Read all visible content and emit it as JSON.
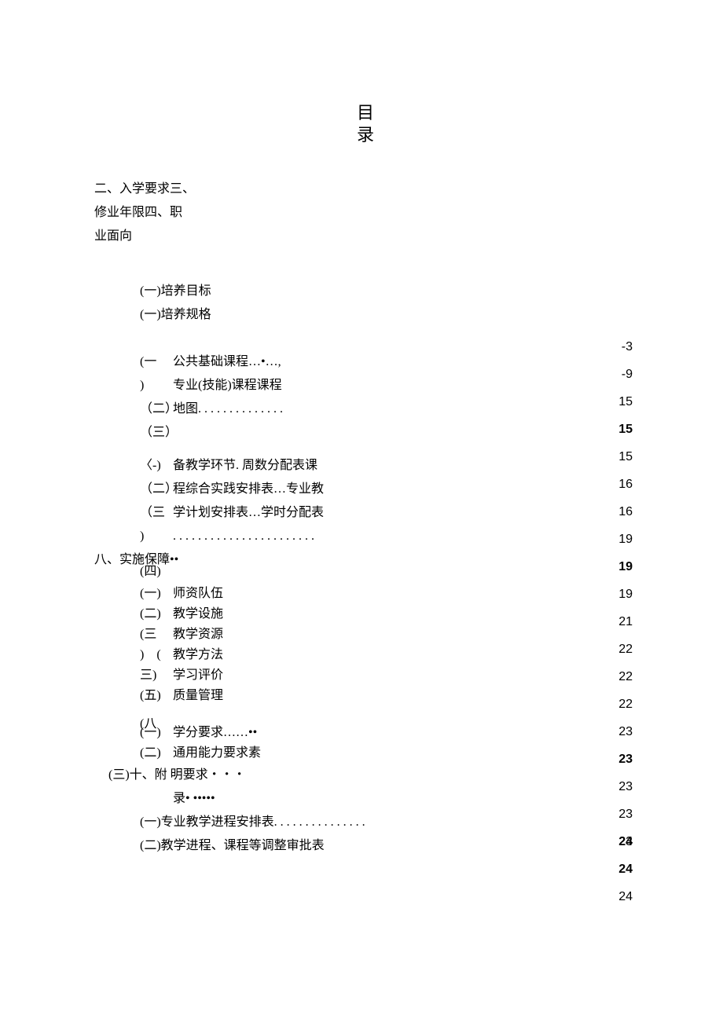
{
  "title_line1": "目",
  "title_line2": "录",
  "intro": {
    "l1": "二、入学要求三、",
    "l2": "修业年限四、职",
    "l3": "业面向"
  },
  "block1": {
    "a": "(一)培养目标",
    "b": "(一)培养规格"
  },
  "rows": [
    {
      "label": "(一",
      "text": "公共基础课程…•…,"
    },
    {
      "label": ")",
      "text": "专业(技能)课程课程"
    },
    {
      "label": "（二）",
      "text": "地图. . . . . . . . . . . . . ."
    },
    {
      "label": "（三）",
      "text": ""
    },
    {
      "label": "〈-)",
      "text": "备教学环节. 周数分配表课"
    },
    {
      "label": "（二）",
      "text": "程综合实践安排表…专业教"
    },
    {
      "label": "（三",
      "text": "学计划安排表…学时分配表"
    },
    {
      "label": ")",
      "text": ". . . . . . . . . . . . . . . . . . . . . . ."
    }
  ],
  "eight": "八、实施保障••",
  "eight_overlay": "(四)",
  "block3": [
    {
      "label": "(一)",
      "text": "师资队伍"
    },
    {
      "label": "(二)",
      "text": "教学设施"
    },
    {
      "label": "(三",
      "text": "教学资源"
    },
    {
      "label": ")　(",
      "text": "教学方法"
    },
    {
      "label": "三)",
      "text": "学习评价"
    },
    {
      "label": "(五)",
      "text": "质量管理"
    }
  ],
  "block4": [
    {
      "label": "(八",
      "text": ""
    },
    {
      "label": "(一)",
      "text": "学分要求……••"
    },
    {
      "label": "(二)",
      "text": "通用能力要求素"
    }
  ],
  "line_san": "(三)十、附 明要求・・・",
  "line_lu": "录• •••••",
  "appendix": {
    "a": "(一)专业教学进程安排表. . . . . . . . . . . . . . .",
    "b": "(二)教学进程、课程等调整审批表"
  },
  "pagenums": [
    {
      "t": "-3",
      "b": false
    },
    {
      "t": "-9",
      "b": false
    },
    {
      "t": "15",
      "b": false
    },
    {
      "t": "15",
      "b": true
    },
    {
      "t": "15",
      "b": false
    },
    {
      "t": "16",
      "b": false
    },
    {
      "t": "16",
      "b": false
    },
    {
      "t": "19",
      "b": false
    },
    {
      "t": "19",
      "b": true
    },
    {
      "t": "19",
      "b": false
    },
    {
      "t": "21",
      "b": false
    },
    {
      "t": "22",
      "b": false
    },
    {
      "t": "22",
      "b": false
    },
    {
      "t": "22",
      "b": false
    },
    {
      "t": "23",
      "b": false
    },
    {
      "t": "23",
      "b": true
    },
    {
      "t": "23",
      "b": false
    },
    {
      "t": "23",
      "b": false
    },
    {
      "t": "24",
      "b": true
    },
    {
      "t": "23",
      "b": false
    },
    {
      "t": "24",
      "b": true
    },
    {
      "t": "24",
      "b": false
    }
  ]
}
